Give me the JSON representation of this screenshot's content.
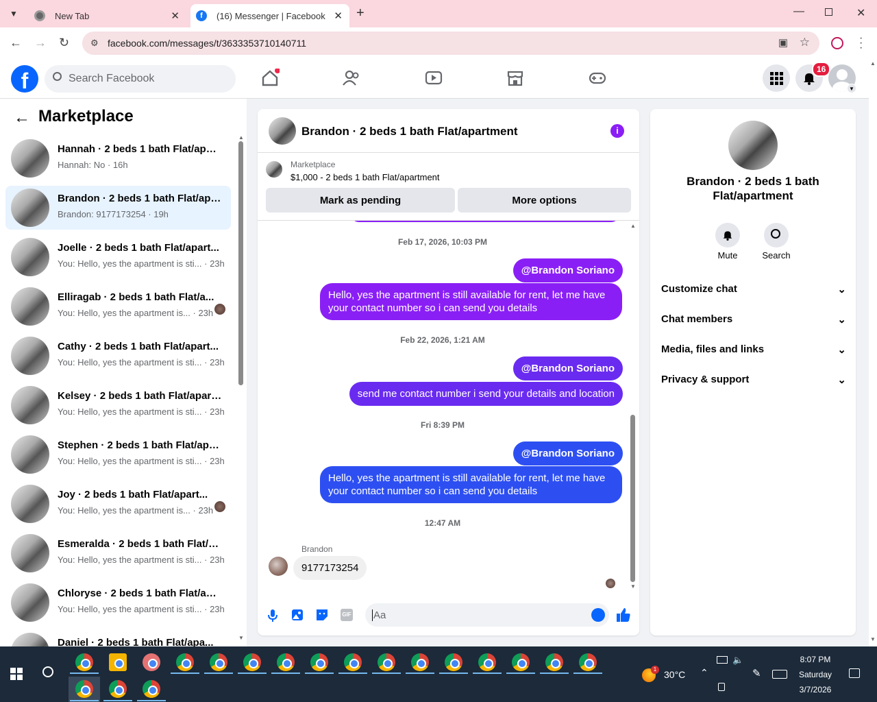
{
  "browser": {
    "tabs": [
      {
        "label": "New Tab"
      },
      {
        "label": "(16) Messenger | Facebook"
      }
    ],
    "url": "facebook.com/messages/t/3633353710140711"
  },
  "fb_header": {
    "search_placeholder": "Search Facebook",
    "notification_count": "16"
  },
  "sidebar": {
    "title": "Marketplace",
    "conversations": [
      {
        "title": "Hannah · 2 beds 1 bath Flat/apar...",
        "preview": "Hannah: No · 16h"
      },
      {
        "title": "Brandon · 2 beds 1 bath Flat/apa...",
        "preview": "Brandon: 9177173254 · 19h"
      },
      {
        "title": "Joelle · 2 beds 1 bath Flat/apart...",
        "preview": "You: Hello, yes the apartment is sti... · 23h"
      },
      {
        "title": "Elliragab · 2 beds 1 bath Flat/a...",
        "preview": "You: Hello, yes the apartment is... · 23h"
      },
      {
        "title": "Cathy · 2 beds 1 bath Flat/apart...",
        "preview": "You: Hello, yes the apartment is sti... · 23h"
      },
      {
        "title": "Kelsey · 2 beds 1 bath Flat/apart...",
        "preview": "You: Hello, yes the apartment is sti... · 23h"
      },
      {
        "title": "Stephen · 2 beds 1 bath Flat/apa...",
        "preview": "You: Hello, yes the apartment is sti... · 23h"
      },
      {
        "title": "Joy · 2 beds 1 bath Flat/apart...",
        "preview": "You: Hello, yes the apartment is... · 23h"
      },
      {
        "title": "Esmeralda · 2 beds 1 bath Flat/a...",
        "preview": "You: Hello, yes the apartment is sti... · 23h"
      },
      {
        "title": "Chloryse · 2 beds 1 bath Flat/apa...",
        "preview": "You: Hello, yes the apartment is sti... · 23h"
      },
      {
        "title": "Daniel · 2 beds 1 bath Flat/apa...",
        "preview": ""
      }
    ]
  },
  "chat": {
    "title": "Brandon · 2 beds 1 bath Flat/apartment",
    "listing_source": "Marketplace",
    "listing_desc": "$1,000 - 2 beds 1 bath Flat/apartment",
    "mark_pending": "Mark as pending",
    "more_options": "More options",
    "messages": [
      {
        "time": "Feb 17, 2026, 10:03 PM",
        "mention": "@Brandon Soriano",
        "text": "Hello, yes the apartment is still available for rent, let me have your contact number so i can send you details"
      },
      {
        "time": "Feb 22, 2026, 1:21 AM",
        "mention": "@Brandon Soriano",
        "text": "send me contact number i send your details and location"
      },
      {
        "time": "Fri 8:39 PM",
        "mention": "@Brandon Soriano",
        "text": "Hello, yes the apartment is still available for rent, let me have your contact number so i can send you details"
      }
    ],
    "reply_time": "12:47 AM",
    "reply_sender": "Brandon",
    "reply_text": "9177173254",
    "composer_placeholder": "Aa",
    "colors": {
      "purple": "#8a1ff5",
      "violet": "#6a2bf0",
      "blue": "#2d4ff2"
    }
  },
  "info_panel": {
    "name": "Brandon · 2 beds 1 bath Flat/apartment",
    "mute": "Mute",
    "search": "Search",
    "sections": [
      "Customize chat",
      "Chat members",
      "Media, files and links",
      "Privacy & support"
    ]
  },
  "taskbar": {
    "temperature": "30°C",
    "weather_badge": "1",
    "time": "8:07 PM",
    "day": "Saturday",
    "date": "3/7/2026"
  }
}
